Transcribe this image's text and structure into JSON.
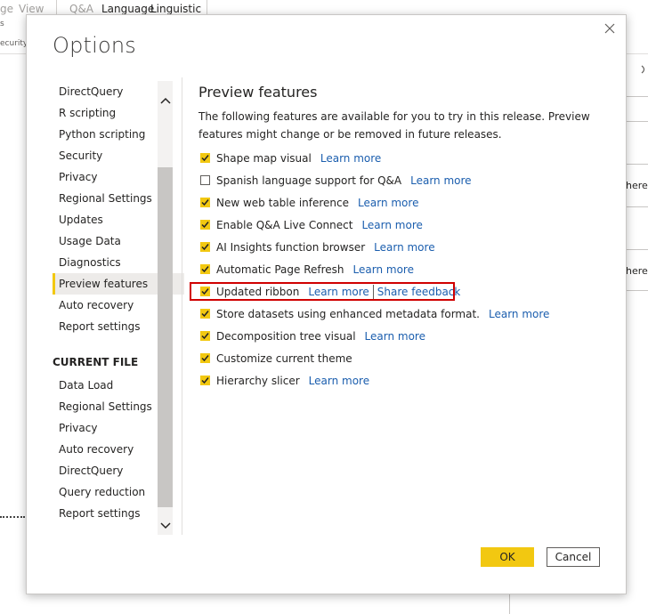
{
  "background": {
    "tabs": [
      "ge",
      "View",
      "Q&A",
      "Language",
      "Linguistic"
    ],
    "fragment_s": "s",
    "fragment_security": "ecurity",
    "right_text_1": "here",
    "right_text_2": "here"
  },
  "dialog": {
    "title": "Options",
    "close_icon": "close-icon"
  },
  "nav": {
    "global_items": [
      "DirectQuery",
      "R scripting",
      "Python scripting",
      "Security",
      "Privacy",
      "Regional Settings",
      "Updates",
      "Usage Data",
      "Diagnostics",
      "Preview features",
      "Auto recovery",
      "Report settings"
    ],
    "selected": "Preview features",
    "current_file_heading": "CURRENT FILE",
    "current_file_items": [
      "Data Load",
      "Regional Settings",
      "Privacy",
      "Auto recovery",
      "DirectQuery",
      "Query reduction",
      "Report settings"
    ]
  },
  "content": {
    "title": "Preview features",
    "description": "The following features are available for you to try in this release. Preview features might change or be removed in future releases.",
    "features": [
      {
        "label": "Shape map visual",
        "checked": true,
        "link": "Learn more"
      },
      {
        "label": "Spanish language support for Q&A",
        "checked": false,
        "link": "Learn more"
      },
      {
        "label": "New web table inference",
        "checked": true,
        "link": "Learn more"
      },
      {
        "label": "Enable Q&A Live Connect",
        "checked": true,
        "link": "Learn more"
      },
      {
        "label": "AI Insights function browser",
        "checked": true,
        "link": "Learn more"
      },
      {
        "label": "Automatic Page Refresh",
        "checked": true,
        "link": "Learn more"
      },
      {
        "label": "Updated ribbon",
        "checked": true,
        "link": "Learn more",
        "link2": "Share feedback",
        "highlighted": true
      },
      {
        "label": "Store datasets using enhanced metadata format.",
        "checked": true,
        "link": "Learn more"
      },
      {
        "label": "Decomposition tree visual",
        "checked": true,
        "link": "Learn more"
      },
      {
        "label": "Customize current theme",
        "checked": true
      },
      {
        "label": "Hierarchy slicer",
        "checked": true,
        "link": "Learn more"
      }
    ]
  },
  "buttons": {
    "ok": "OK",
    "cancel": "Cancel"
  },
  "colors": {
    "accent": "#f2c811",
    "link": "#1b5eae",
    "highlight_border": "#d00000"
  }
}
